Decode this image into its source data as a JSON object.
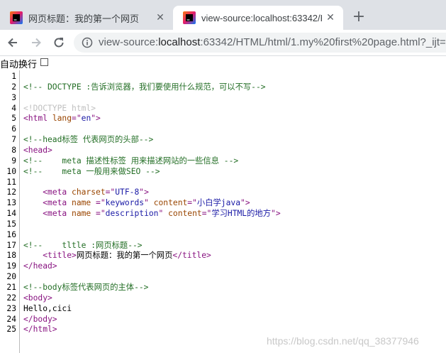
{
  "tabs": [
    {
      "title": "网页标题：我的第一个网页",
      "active": false
    },
    {
      "title": "view-source:localhost:63342/H",
      "active": true
    }
  ],
  "new_tab_label": "+",
  "close_glyph": "✕",
  "address": {
    "scheme": "view-source:",
    "host": "localhost",
    "rest": ":63342/HTML/html/1.my%20first%20page.html?_ijt="
  },
  "wrap_label": "自动换行",
  "source_lines": [
    {
      "n": "1",
      "html": ""
    },
    {
      "n": "2",
      "html": "<span class=\"c-comment\">&lt;!-- DOCTYPE :告诉浏览器，我们要使用什么规范，可以不写--&gt;</span>"
    },
    {
      "n": "3",
      "html": ""
    },
    {
      "n": "4",
      "html": "<span class=\"c-doctype\">&lt;!DOCTYPE html&gt;</span>"
    },
    {
      "n": "5",
      "html": "<span class=\"c-tag\">&lt;html </span><span class=\"c-attr\">lang</span><span class=\"c-tag\">=\"</span><span class=\"c-val\">en</span><span class=\"c-tag\">\"&gt;</span>"
    },
    {
      "n": "6",
      "html": ""
    },
    {
      "n": "7",
      "html": "<span class=\"c-comment\">&lt;!--head标签 代表网页的头部--&gt;</span>"
    },
    {
      "n": "8",
      "html": "<span class=\"c-tag\">&lt;head&gt;</span>"
    },
    {
      "n": "9",
      "html": "<span class=\"c-comment\">&lt;!--    meta 描述性标签 用来描述网站的一些信息 --&gt;</span>"
    },
    {
      "n": "10",
      "html": "<span class=\"c-comment\">&lt;!--    meta 一般用来做SEO --&gt;</span>"
    },
    {
      "n": "11",
      "html": ""
    },
    {
      "n": "12",
      "html": "    <span class=\"c-tag\">&lt;meta </span><span class=\"c-attr\">charset</span><span class=\"c-tag\">=\"</span><span class=\"c-val\">UTF-8</span><span class=\"c-tag\">\"&gt;</span>"
    },
    {
      "n": "13",
      "html": "    <span class=\"c-tag\">&lt;meta </span><span class=\"c-attr\">name </span><span class=\"c-tag\">=\"</span><span class=\"c-val\">keywords</span><span class=\"c-tag\">\" </span><span class=\"c-attr\">content</span><span class=\"c-tag\">=\"</span><span class=\"c-val\">小白学java</span><span class=\"c-tag\">\"&gt;</span>"
    },
    {
      "n": "14",
      "html": "    <span class=\"c-tag\">&lt;meta </span><span class=\"c-attr\">name </span><span class=\"c-tag\">=\"</span><span class=\"c-val\">description</span><span class=\"c-tag\">\" </span><span class=\"c-attr\">content</span><span class=\"c-tag\">=\"</span><span class=\"c-val\">学习HTML的地方</span><span class=\"c-tag\">\"&gt;</span>"
    },
    {
      "n": "15",
      "html": ""
    },
    {
      "n": "16",
      "html": ""
    },
    {
      "n": "17",
      "html": "<span class=\"c-comment\">&lt;!--    tltle :网页标题--&gt;</span>"
    },
    {
      "n": "18",
      "html": "    <span class=\"c-tag\">&lt;title&gt;</span>网页标题：我的第一个网页<span class=\"c-tag\">&lt;/title&gt;</span>"
    },
    {
      "n": "19",
      "html": "<span class=\"c-tag\">&lt;/head&gt;</span>"
    },
    {
      "n": "20",
      "html": ""
    },
    {
      "n": "21",
      "html": "<span class=\"c-comment\">&lt;!--body标签代表网页的主体--&gt;</span>"
    },
    {
      "n": "22",
      "html": "<span class=\"c-tag\">&lt;body&gt;</span>"
    },
    {
      "n": "23",
      "html": "Hello,cici"
    },
    {
      "n": "24",
      "html": "<span class=\"c-tag\">&lt;/body&gt;</span>"
    },
    {
      "n": "25",
      "html": "<span class=\"c-tag\">&lt;/html&gt;</span>"
    }
  ],
  "watermark": "https://blog.csdn.net/qq_38377946",
  "colors": {
    "tag": "#881280",
    "attr": "#994500",
    "value": "#1a1aa6",
    "comment": "#236e25",
    "doctype": "#c0c0c0"
  }
}
